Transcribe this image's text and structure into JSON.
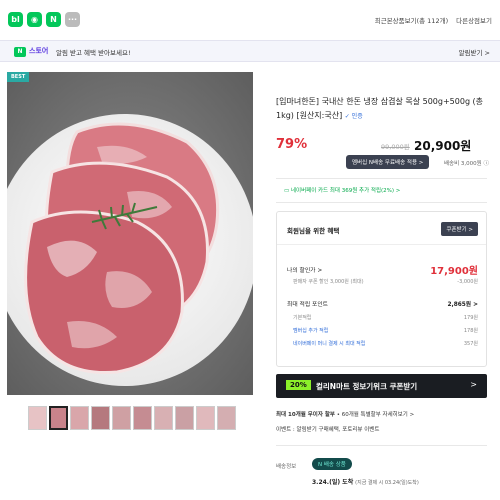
{
  "topbar": {
    "icons": [
      {
        "label": "bl",
        "color": "#03c75a",
        "name": "blog-icon"
      },
      {
        "label": "◉",
        "color": "#03c75a",
        "name": "cafe-icon"
      },
      {
        "label": "N",
        "color": "#03c75a",
        "name": "naver-icon"
      },
      {
        "label": "···",
        "color": "#bbbbbb",
        "name": "more-icon"
      }
    ],
    "history": "최근본상품보기(총 112개)",
    "other": "다른상점보기"
  },
  "banner": {
    "brand": "스토어",
    "text": "알림 받고 혜택 받아보세요!",
    "action": "알림받기 >"
  },
  "product": {
    "best_tag": "BEST",
    "title": "[입마녀한돈] 국내산 한돈 냉장 삼겹살 목살 500g+500g (총 1kg) [원산지:국산]",
    "verified": "✓ 인증",
    "discount": "79%",
    "original_price": "99,000원",
    "price": "20,900원",
    "shipping_tag": "멤버십 N배송 무료배송 적용 >",
    "shipping_extra": "배송비 3,000원 ⓘ",
    "card_benefit": "네이버페이 카드 최대 369원 추가 적립(2%) >"
  },
  "thumbnails": [
    "thumb-1",
    "thumb-2",
    "thumb-3",
    "thumb-4",
    "thumb-5",
    "thumb-6",
    "thumb-7",
    "thumb-8",
    "thumb-9",
    "thumb-10"
  ],
  "coupon": {
    "title": "회원님을 위한 혜택",
    "button": "쿠폰받기 >",
    "my_price_label": "나의 할인가 >",
    "my_price": "17,900원",
    "my_price_sub": "판매자 쿠폰 할인 3,000원 (최대)",
    "my_price_sub_val": "-3,000원",
    "points_label": "최대 적립 포인트",
    "points": "2,865원 >",
    "points_rows": [
      {
        "label": "기본적립",
        "value": "179원"
      },
      {
        "label": "멤버십 추가 적립",
        "value": "178원"
      },
      {
        "label": "네이버페이 머니 결제 시 최대 적립",
        "value": "357원"
      }
    ]
  },
  "promo": {
    "pct": "20%",
    "text": "컬리N마트 정보기위크 쿠폰받기",
    "arrow": ">"
  },
  "info": {
    "line1_bold": "최대 10개월 무이자 할부",
    "line1_rest": " • 60개월 특별할부 자세히보기 >",
    "line2": "이벤트 : 알림받기 구매혜택, 포토리뷰 이벤트"
  },
  "delivery": {
    "label": "배송정보",
    "badge": "N 배송 상품",
    "date": "3.24.(일) 도착",
    "date_note": "(지금 결제 시 03.24(일)도착)"
  }
}
